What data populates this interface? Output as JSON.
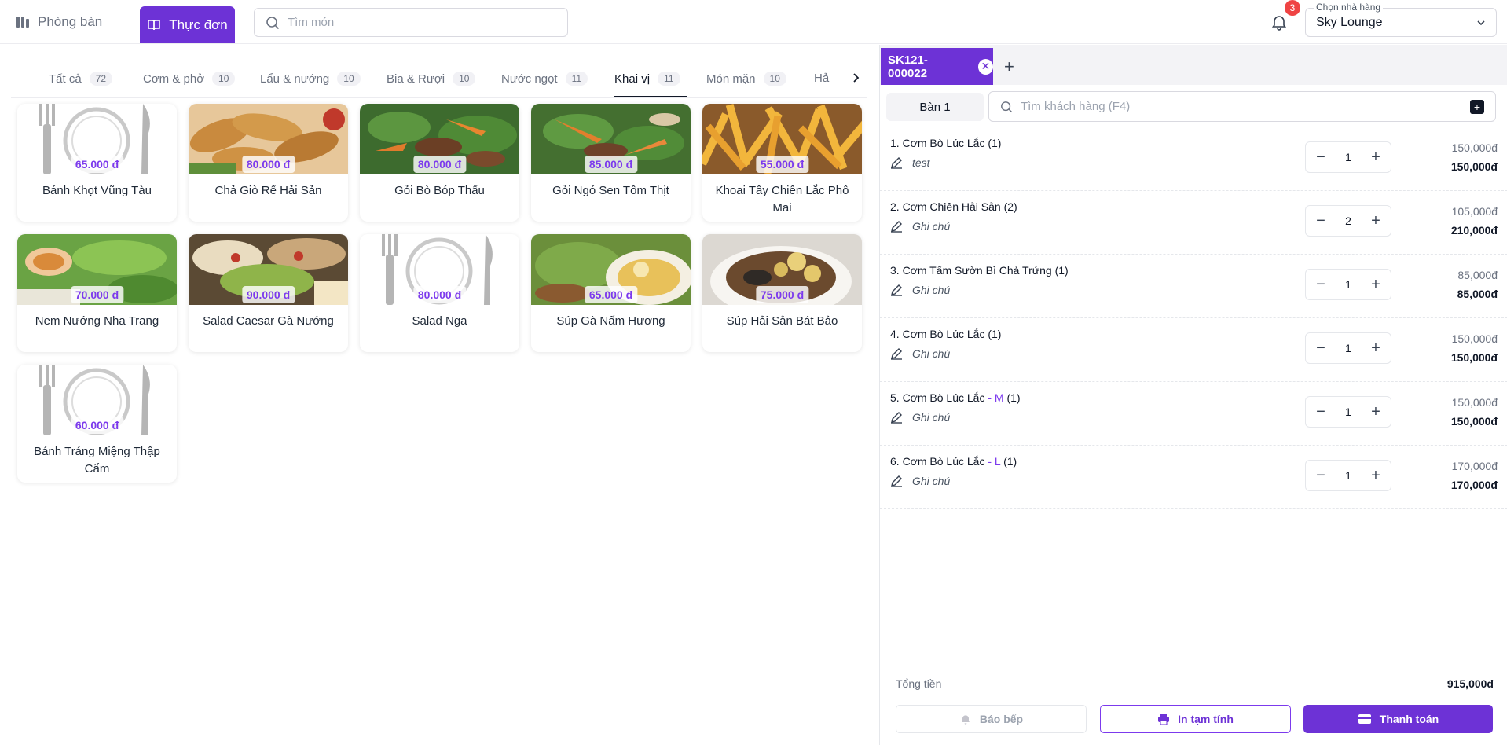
{
  "nav": {
    "rooms_label": "Phòng bàn",
    "menu_label": "Thực đơn",
    "search_placeholder": "Tìm món",
    "notification_count": "3",
    "restaurant_label": "Chọn nhà hàng",
    "restaurant_value": "Sky Lounge"
  },
  "categories": [
    {
      "label": "Tất cả",
      "count": "72"
    },
    {
      "label": "Cơm & phở",
      "count": "10"
    },
    {
      "label": "Lẩu & nướng",
      "count": "10"
    },
    {
      "label": "Bia & Rượi",
      "count": "10"
    },
    {
      "label": "Nước ngọt",
      "count": "11"
    },
    {
      "label": "Khai vị",
      "count": "11"
    },
    {
      "label": "Món mặn",
      "count": "10"
    },
    {
      "label": "Hả"
    }
  ],
  "active_category": "Khai vị",
  "dishes": [
    {
      "name": "Bánh Khọt Vũng Tàu",
      "price": "65.000 đ"
    },
    {
      "name": "Chả Giò Rế Hải Sản",
      "price": "80.000 đ"
    },
    {
      "name": "Gỏi Bò Bóp Thấu",
      "price": "80.000 đ"
    },
    {
      "name": "Gỏi Ngó Sen Tôm Thịt",
      "price": "85.000 đ"
    },
    {
      "name": "Khoai Tây Chiên Lắc Phô Mai",
      "price": "55.000 đ"
    },
    {
      "name": "Nem Nướng Nha Trang",
      "price": "70.000 đ"
    },
    {
      "name": "Salad Caesar Gà Nướng",
      "price": "90.000 đ"
    },
    {
      "name": "Salad Nga",
      "price": "80.000 đ"
    },
    {
      "name": "Súp Gà Nấm Hương",
      "price": "65.000 đ"
    },
    {
      "name": "Súp Hải Sản Bát Bảo",
      "price": "75.000 đ"
    },
    {
      "name": "Bánh Tráng Miệng Thập Cẩm",
      "price": "60.000 đ"
    }
  ],
  "order": {
    "tab_label": "SK121-000022",
    "table_label": "Bàn 1",
    "customer_search_placeholder": "Tìm khách hàng (F4)",
    "items": [
      {
        "title": "1. Cơm Bò Lúc Lắc",
        "variant": "",
        "suffix": " (1)",
        "note": "test",
        "qty": "1",
        "unit_price": "150,000đ",
        "total": "150,000đ"
      },
      {
        "title": "2. Cơm Chiên Hải Sản",
        "variant": "",
        "suffix": " (2)",
        "note": "Ghi chú",
        "qty": "2",
        "unit_price": "105,000đ",
        "total": "210,000đ"
      },
      {
        "title": "3. Cơm Tấm Sườn Bì Chả Trứng",
        "variant": "",
        "suffix": " (1)",
        "note": "Ghi chú",
        "qty": "1",
        "unit_price": "85,000đ",
        "total": "85,000đ"
      },
      {
        "title": "4. Cơm Bò Lúc Lắc",
        "variant": "",
        "suffix": " (1)",
        "note": "Ghi chú",
        "qty": "1",
        "unit_price": "150,000đ",
        "total": "150,000đ"
      },
      {
        "title": "5. Cơm Bò Lúc Lắc",
        "variant": " - M",
        "suffix": " (1)",
        "note": "Ghi chú",
        "qty": "1",
        "unit_price": "150,000đ",
        "total": "150,000đ"
      },
      {
        "title": "6. Cơm Bò Lúc Lắc",
        "variant": " - L",
        "suffix": " (1)",
        "note": "Ghi chú",
        "qty": "1",
        "unit_price": "170,000đ",
        "total": "170,000đ"
      }
    ],
    "total_label": "Tổng tiền",
    "total_value": "915,000đ",
    "kitchen_button": "Báo bếp",
    "print_button": "In tạm tính",
    "pay_button": "Thanh toán"
  },
  "colors": {
    "accent": "#6d32d6",
    "price": "#7c3aed",
    "badge": "#ef4444"
  }
}
